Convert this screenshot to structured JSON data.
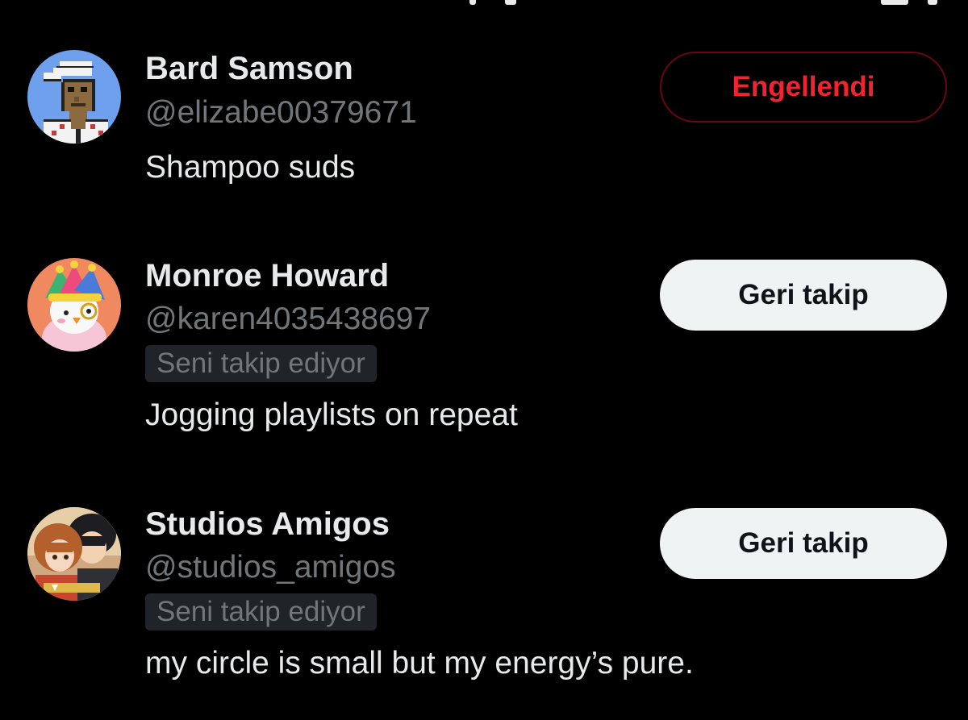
{
  "users": [
    {
      "name": "Bard Samson",
      "handle": "@elizabe00379671",
      "follows_you_label": "",
      "bio": "Shampoo suds",
      "action_label": "Engellendi",
      "action_state": "blocked",
      "avatar_icon": "pixel-art-avatar-icon"
    },
    {
      "name": "Monroe Howard",
      "handle": "@karen4035438697",
      "follows_you_label": "Seni takip ediyor",
      "bio": "Jogging playlists on repeat",
      "action_label": "Geri takip",
      "action_state": "follow-back",
      "avatar_icon": "jester-penguin-avatar-icon"
    },
    {
      "name": "Studios Amigos",
      "handle": "@studios_amigos",
      "follows_you_label": "Seni takip ediyor",
      "bio": "my circle is small but my energy’s pure.",
      "action_label": "Geri takip",
      "action_state": "follow-back",
      "avatar_icon": "anime-couple-avatar-icon"
    }
  ],
  "colors": {
    "background": "#000000",
    "primary_text": "#e7e9ea",
    "secondary_text": "#71767b",
    "badge_bg": "#202327",
    "blocked_text": "#f4212e",
    "blocked_border": "#67070f",
    "follow_button_bg": "#eff3f4",
    "follow_button_text": "#0f1419"
  }
}
